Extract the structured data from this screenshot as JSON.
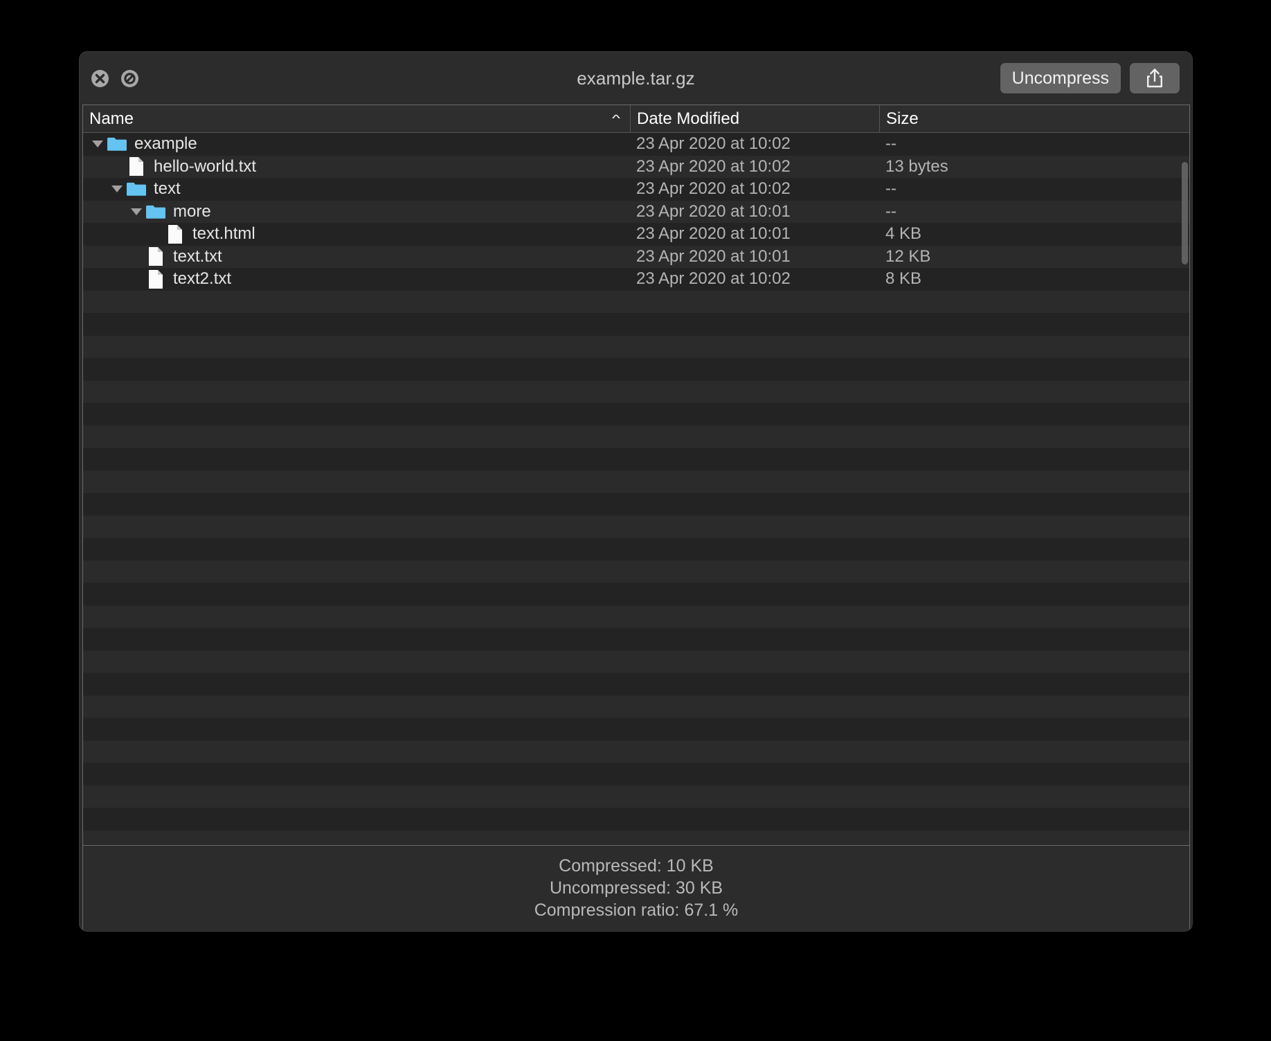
{
  "window": {
    "title": "example.tar.gz",
    "close_icon": "close-x-circle-icon",
    "stop_icon": "stop-slash-circle-icon"
  },
  "toolbar": {
    "uncompress_label": "Uncompress",
    "share_icon": "share-upload-icon"
  },
  "table": {
    "columns": [
      {
        "key": "name",
        "label": "Name",
        "sort": "ascending",
        "sort_caret": "^"
      },
      {
        "key": "date",
        "label": "Date Modified"
      },
      {
        "key": "size",
        "label": "Size"
      }
    ],
    "rows": [
      {
        "name": "example",
        "depth": 0,
        "type": "folder",
        "expanded": true,
        "date": "23 Apr 2020 at 10:02",
        "size": "--"
      },
      {
        "name": "hello-world.txt",
        "depth": 1,
        "type": "file",
        "expanded": false,
        "date": "23 Apr 2020 at 10:02",
        "size": "13 bytes"
      },
      {
        "name": "text",
        "depth": 1,
        "type": "folder",
        "expanded": true,
        "date": "23 Apr 2020 at 10:02",
        "size": "--"
      },
      {
        "name": "more",
        "depth": 2,
        "type": "folder",
        "expanded": true,
        "date": "23 Apr 2020 at 10:01",
        "size": "--"
      },
      {
        "name": "text.html",
        "depth": 3,
        "type": "file",
        "expanded": false,
        "date": "23 Apr 2020 at 10:01",
        "size": "4 KB"
      },
      {
        "name": "text.txt",
        "depth": 2,
        "type": "file",
        "expanded": false,
        "date": "23 Apr 2020 at 10:01",
        "size": "12 KB"
      },
      {
        "name": "text2.txt",
        "depth": 2,
        "type": "file",
        "expanded": false,
        "date": "23 Apr 2020 at 10:02",
        "size": "8 KB"
      }
    ],
    "empty_row_count": 26
  },
  "footer": {
    "lines": [
      "Compressed: 10 KB",
      "Uncompressed: 30 KB",
      "Compression ratio: 67.1 %"
    ]
  },
  "colors": {
    "folder_blue": "#64c3f0",
    "document_white": "#fbfbfb",
    "window_chrome": "#2c2c2c",
    "row_odd": "#232323",
    "row_even": "#2b2b2b",
    "accent_button": "#636363",
    "desktop": "#000000"
  }
}
